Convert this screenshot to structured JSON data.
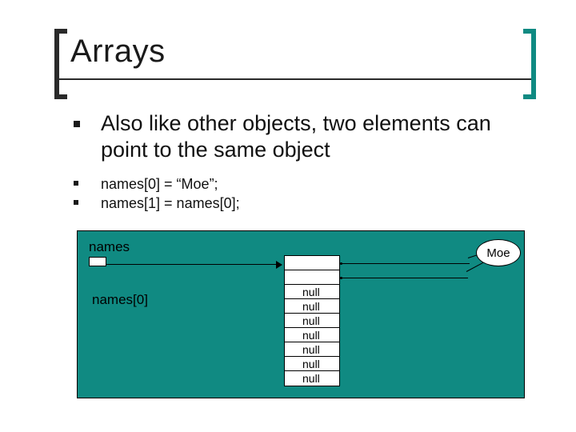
{
  "title": "Arrays",
  "bullets": {
    "main": "Also like other objects, two elements can point to the same object",
    "code1": "names[0] = “Moe”;",
    "code2": "names[1] = names[0];"
  },
  "diagram": {
    "names_label": "names",
    "names0_label": "names[0]",
    "object_label": "Moe",
    "cells": [
      "",
      "",
      "null",
      "null",
      "null",
      "null",
      "null",
      "null",
      "null"
    ]
  }
}
